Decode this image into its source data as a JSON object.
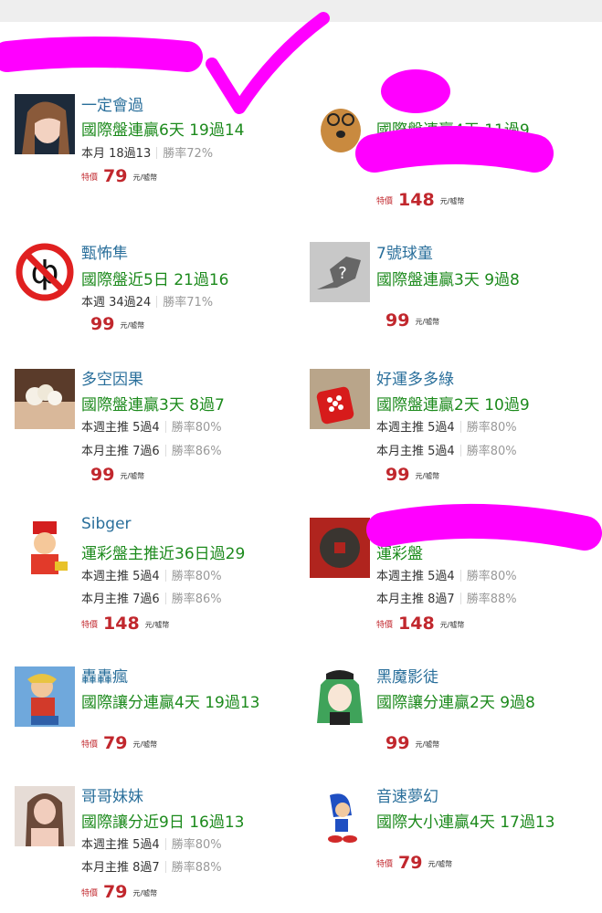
{
  "cards": [
    {
      "name": "一定會過",
      "record": "國際盤連贏6天 19過14",
      "stats": [
        {
          "label": "本月 18過13",
          "rate": "勝率72%"
        }
      ],
      "price": {
        "tag": "特價",
        "value": "79",
        "unit": "元/噓幣"
      }
    },
    {
      "name": "",
      "record": "國際盤連贏4天 11過9",
      "stats": [],
      "price": {
        "tag": "特價",
        "value": "148",
        "unit": "元/噓幣"
      }
    },
    {
      "name": "甄怖隼",
      "record": "國際盤近5日 21過16",
      "stats": [
        {
          "label": "本週 34過24",
          "rate": "勝率71%"
        }
      ],
      "price": {
        "tag": "",
        "value": "99",
        "unit": "元/噓幣"
      }
    },
    {
      "name": "7號球童",
      "record": "國際盤連贏3天 9過8",
      "stats": [],
      "price": {
        "tag": "",
        "value": "99",
        "unit": "元/噓幣"
      }
    },
    {
      "name": "多空因果",
      "record": "國際盤連贏3天 8過7",
      "stats": [
        {
          "label": "本週主推 5過4",
          "rate": "勝率80%"
        },
        {
          "label": "本月主推 7過6",
          "rate": "勝率86%"
        }
      ],
      "price": {
        "tag": "",
        "value": "99",
        "unit": "元/噓幣"
      }
    },
    {
      "name": "好運多多綠",
      "record": "國際盤連贏2天 10過9",
      "stats": [
        {
          "label": "本週主推 5過4",
          "rate": "勝率80%"
        },
        {
          "label": "本月主推 5過4",
          "rate": "勝率80%"
        }
      ],
      "price": {
        "tag": "",
        "value": "99",
        "unit": "元/噓幣"
      }
    },
    {
      "name": "Sibger",
      "record": "運彩盤主推近36日過29",
      "stats": [
        {
          "label": "本週主推 5過4",
          "rate": "勝率80%"
        },
        {
          "label": "本月主推 7過6",
          "rate": "勝率86%"
        }
      ],
      "price": {
        "tag": "特價",
        "value": "148",
        "unit": "元/噓幣"
      }
    },
    {
      "name": "",
      "record": "運彩盤",
      "stats": [
        {
          "label": "本週主推 5過4",
          "rate": "勝率80%"
        },
        {
          "label": "本月主推 8過7",
          "rate": "勝率88%"
        }
      ],
      "price": {
        "tag": "特價",
        "value": "148",
        "unit": "元/噓幣"
      }
    },
    {
      "name": "轟轟瘋",
      "record": "國際讓分連贏4天 19過13",
      "stats": [],
      "price": {
        "tag": "特價",
        "value": "79",
        "unit": "元/噓幣"
      }
    },
    {
      "name": "黑魔影徒",
      "record": "國際讓分連贏2天 9過8",
      "stats": [],
      "price": {
        "tag": "",
        "value": "99",
        "unit": "元/噓幣"
      }
    },
    {
      "name": "哥哥妹妹",
      "record": "國際讓分近9日 16過13",
      "stats": [
        {
          "label": "本週主推 5過4",
          "rate": "勝率80%"
        },
        {
          "label": "本月主推 8過7",
          "rate": "勝率88%"
        }
      ],
      "price": {
        "tag": "特價",
        "value": "79",
        "unit": "元/噓幣"
      }
    },
    {
      "name": "音速夢幻",
      "record": "國際大小連贏4天 17過13",
      "stats": [],
      "price": {
        "tag": "特價",
        "value": "79",
        "unit": "元/噓幣"
      }
    }
  ],
  "colors": {
    "name": "#2a6f9b",
    "record": "#1c8a1c",
    "price": "#c1272d",
    "scribble": "#ff00ff"
  }
}
